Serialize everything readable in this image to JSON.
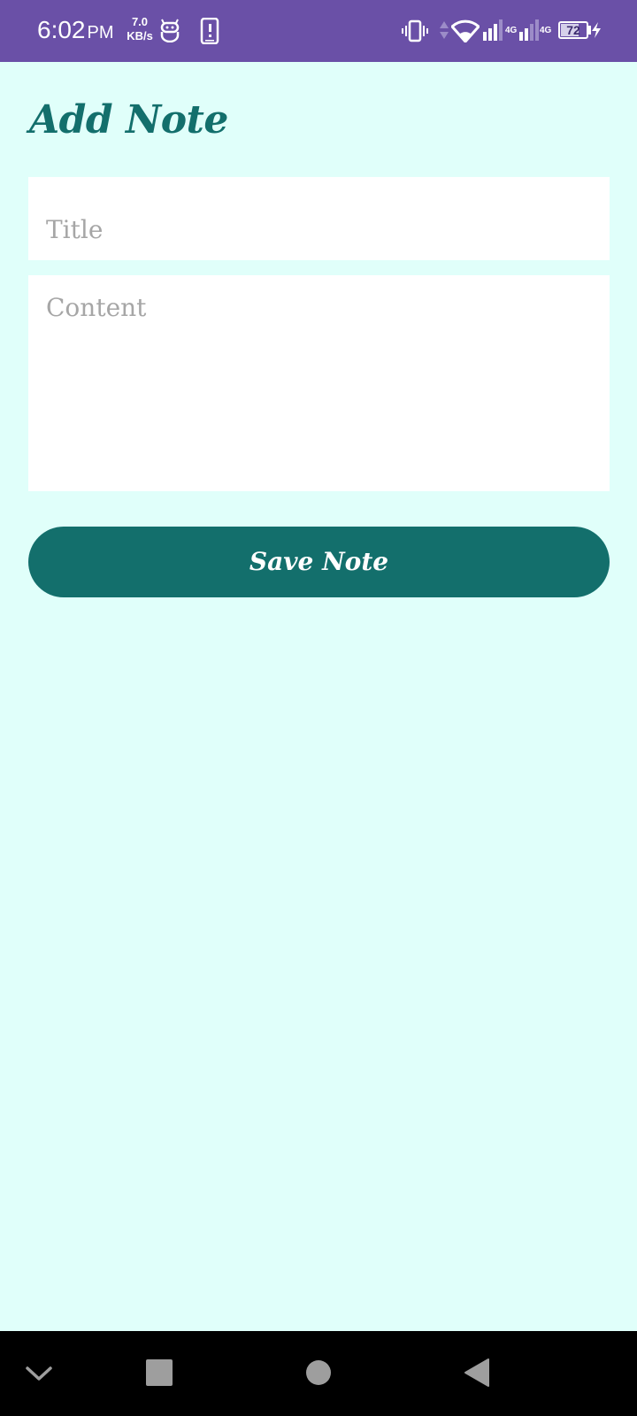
{
  "status_bar": {
    "time": "6:02",
    "ampm": "PM",
    "speed_value": "7.0",
    "speed_unit": "KB/s",
    "network_1": "4G",
    "network_2": "4G",
    "battery_level": "72",
    "battery_fraction": 0.72,
    "icons": [
      "android-icon",
      "phone-alert-icon",
      "vibrate-icon",
      "data-arrows-icon",
      "wifi-icon",
      "signal-icon",
      "signal-icon",
      "battery-icon",
      "charging-icon"
    ]
  },
  "page": {
    "title": "Add Note"
  },
  "form": {
    "title_placeholder": "Title",
    "content_placeholder": "Content",
    "save_label": "Save Note"
  },
  "nav_bar": {
    "icons": [
      "chevron-down-icon",
      "recents-icon",
      "home-icon",
      "back-icon"
    ]
  },
  "colors": {
    "status_bar": "#6a50a7",
    "background": "#e0fffa",
    "accent": "#136f6c",
    "field": "#ffffff",
    "nav_bar": "#000000"
  }
}
